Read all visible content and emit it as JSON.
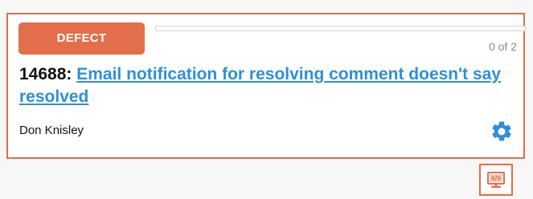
{
  "card": {
    "type_label": "DEFECT",
    "progress": {
      "count_text": "0 of 2",
      "fraction": 0
    },
    "id_prefix": "14688:",
    "title": "Email notification for resolving comment doesn't say resolved",
    "owner": "Don Knisley"
  },
  "icons": {
    "settings": "gear-icon",
    "code_preview": "monitor-code-icon"
  },
  "colors": {
    "accent": "#e26e4c",
    "link": "#2f8fd6",
    "gear": "#2f8fd6"
  }
}
